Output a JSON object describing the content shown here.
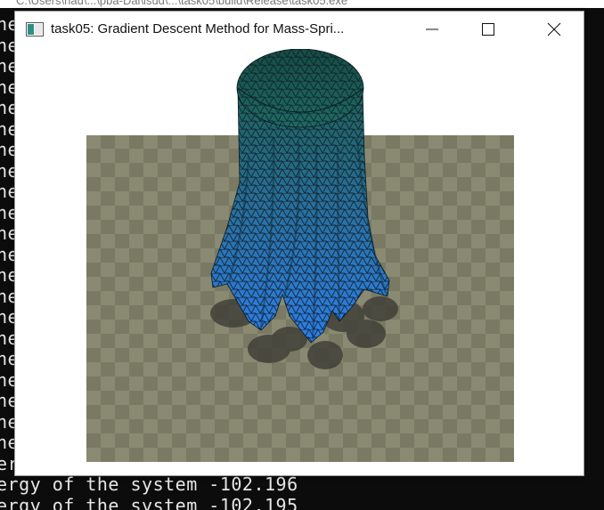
{
  "console": {
    "path": "C:\\Users\\nau\\...\\pba-Dai\\lsud\\...\\task05\\build\\Release\\task05.exe",
    "lines": [
      "ne",
      "ne",
      "ne",
      "ne",
      "ne",
      "ne",
      "ne",
      "ne",
      "ne",
      "ne",
      "ne",
      "ne",
      "ne",
      "ne",
      "ne",
      "ne",
      "ne",
      "ne",
      "ne",
      "ne",
      "ne",
      "ergy of the system -102.196",
      "ergy of the system -102.196",
      "ergy of the system -102.195"
    ]
  },
  "window": {
    "title": "task05: Gradient Descent Method for Mass-Spri...",
    "icon": "application-window-icon",
    "minimize_icon": "minimize-icon",
    "maximize_icon": "maximize-icon",
    "close_icon": "close-icon"
  },
  "scene": {
    "description_free": true,
    "colors": {
      "floor_light": "#8a8a73",
      "floor_dark": "#7a7a64",
      "cloth_top": "#1e5f55",
      "cloth_bottom": "#2f7ee8",
      "mesh_lines": "#0a1a20",
      "shadow": "#3c3c36"
    }
  }
}
